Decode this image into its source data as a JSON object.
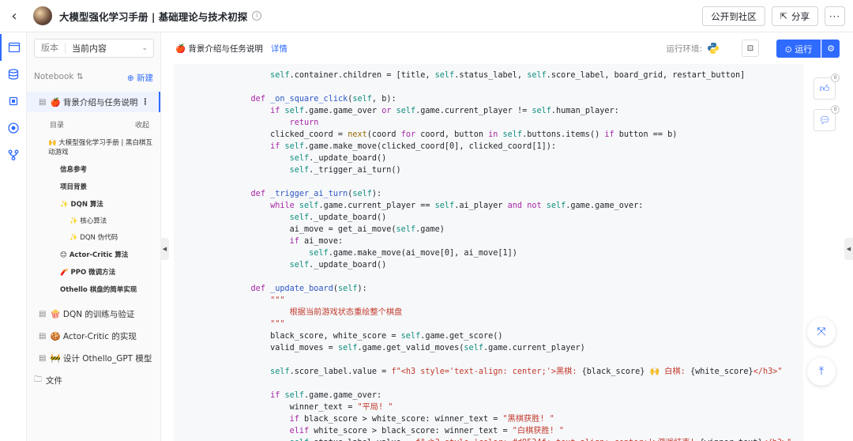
{
  "topbar": {
    "back_icon": "chevron-left-icon",
    "title": "大模型强化学习手册 | 基础理论与技术初探",
    "publish_label": "公开到社区",
    "share_label": "分享",
    "more_label": "···"
  },
  "sidebar": {
    "version_label": "版本",
    "version_value": "当前内容",
    "notebook_label": "Notebook ⇅",
    "new_label": "⊕ 新建",
    "active_file": "🍎 背景介绍与任务说明",
    "toc_label": "目录",
    "toc_collapse": "收起",
    "toc": [
      {
        "level": 1,
        "text": "🙌 大模型强化学习手册 | 黑白棋互动游戏"
      },
      {
        "level": 2,
        "text": "信息参考"
      },
      {
        "level": 2,
        "text": "项目背景"
      },
      {
        "level": 2,
        "text": "✨ DQN 算法"
      },
      {
        "level": 3,
        "text": "✨ 核心算法"
      },
      {
        "level": 3,
        "text": "✨ DQN 伪代码"
      },
      {
        "level": 2,
        "text": "😊 Actor-Critic 算法"
      },
      {
        "level": 2,
        "text": "🧨 PPO 微调方法"
      },
      {
        "level": 2,
        "text": "Othello 棋盘的简单实现"
      }
    ],
    "files": [
      "🍿 DQN 的训练与验证",
      "🍪 Actor-Critic 的实现",
      "🚧 设计 Othello_GPT 模型"
    ],
    "folder": "文件"
  },
  "main": {
    "section_title": "🍎 背景介绍与任务说明",
    "detail_link": "详情",
    "env_label": "运行环境:",
    "run_label": "⊙ 运行",
    "like_count": "0",
    "comment_count": "0"
  },
  "colors": {
    "accent": "#2f6bff",
    "code_bg": "#f7f8fa",
    "keyword": "#a626a4",
    "string": "#c0392b"
  }
}
